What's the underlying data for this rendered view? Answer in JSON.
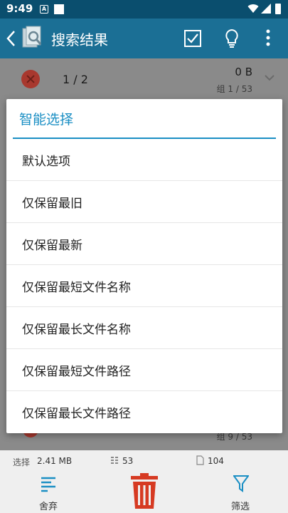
{
  "status_bar": {
    "time": "9:49",
    "notif_badge": "A"
  },
  "app_bar": {
    "title": "搜索结果"
  },
  "group_row": {
    "count": "1 / 2",
    "size": "0 B",
    "group_index": "组 1 / 53"
  },
  "bottom_group_index": "组 9 / 53",
  "dialog": {
    "title": "智能选择",
    "options": [
      "默认选项",
      "仅保留最旧",
      "仅保留最新",
      "仅保留最短文件名称",
      "仅保留最长文件名称",
      "仅保留最短文件路径",
      "仅保留最长文件路径"
    ]
  },
  "summary": {
    "label": "选择",
    "size": "2.41 MB",
    "groups": "53",
    "files": "104"
  },
  "toolbar": {
    "discard_label": "舍弃",
    "filter_label": "筛选"
  },
  "colors": {
    "accent": "#1b8fc4",
    "app_bar": "#1b6f95",
    "status_bar": "#0a4e6e",
    "delete": "#d63a22"
  }
}
